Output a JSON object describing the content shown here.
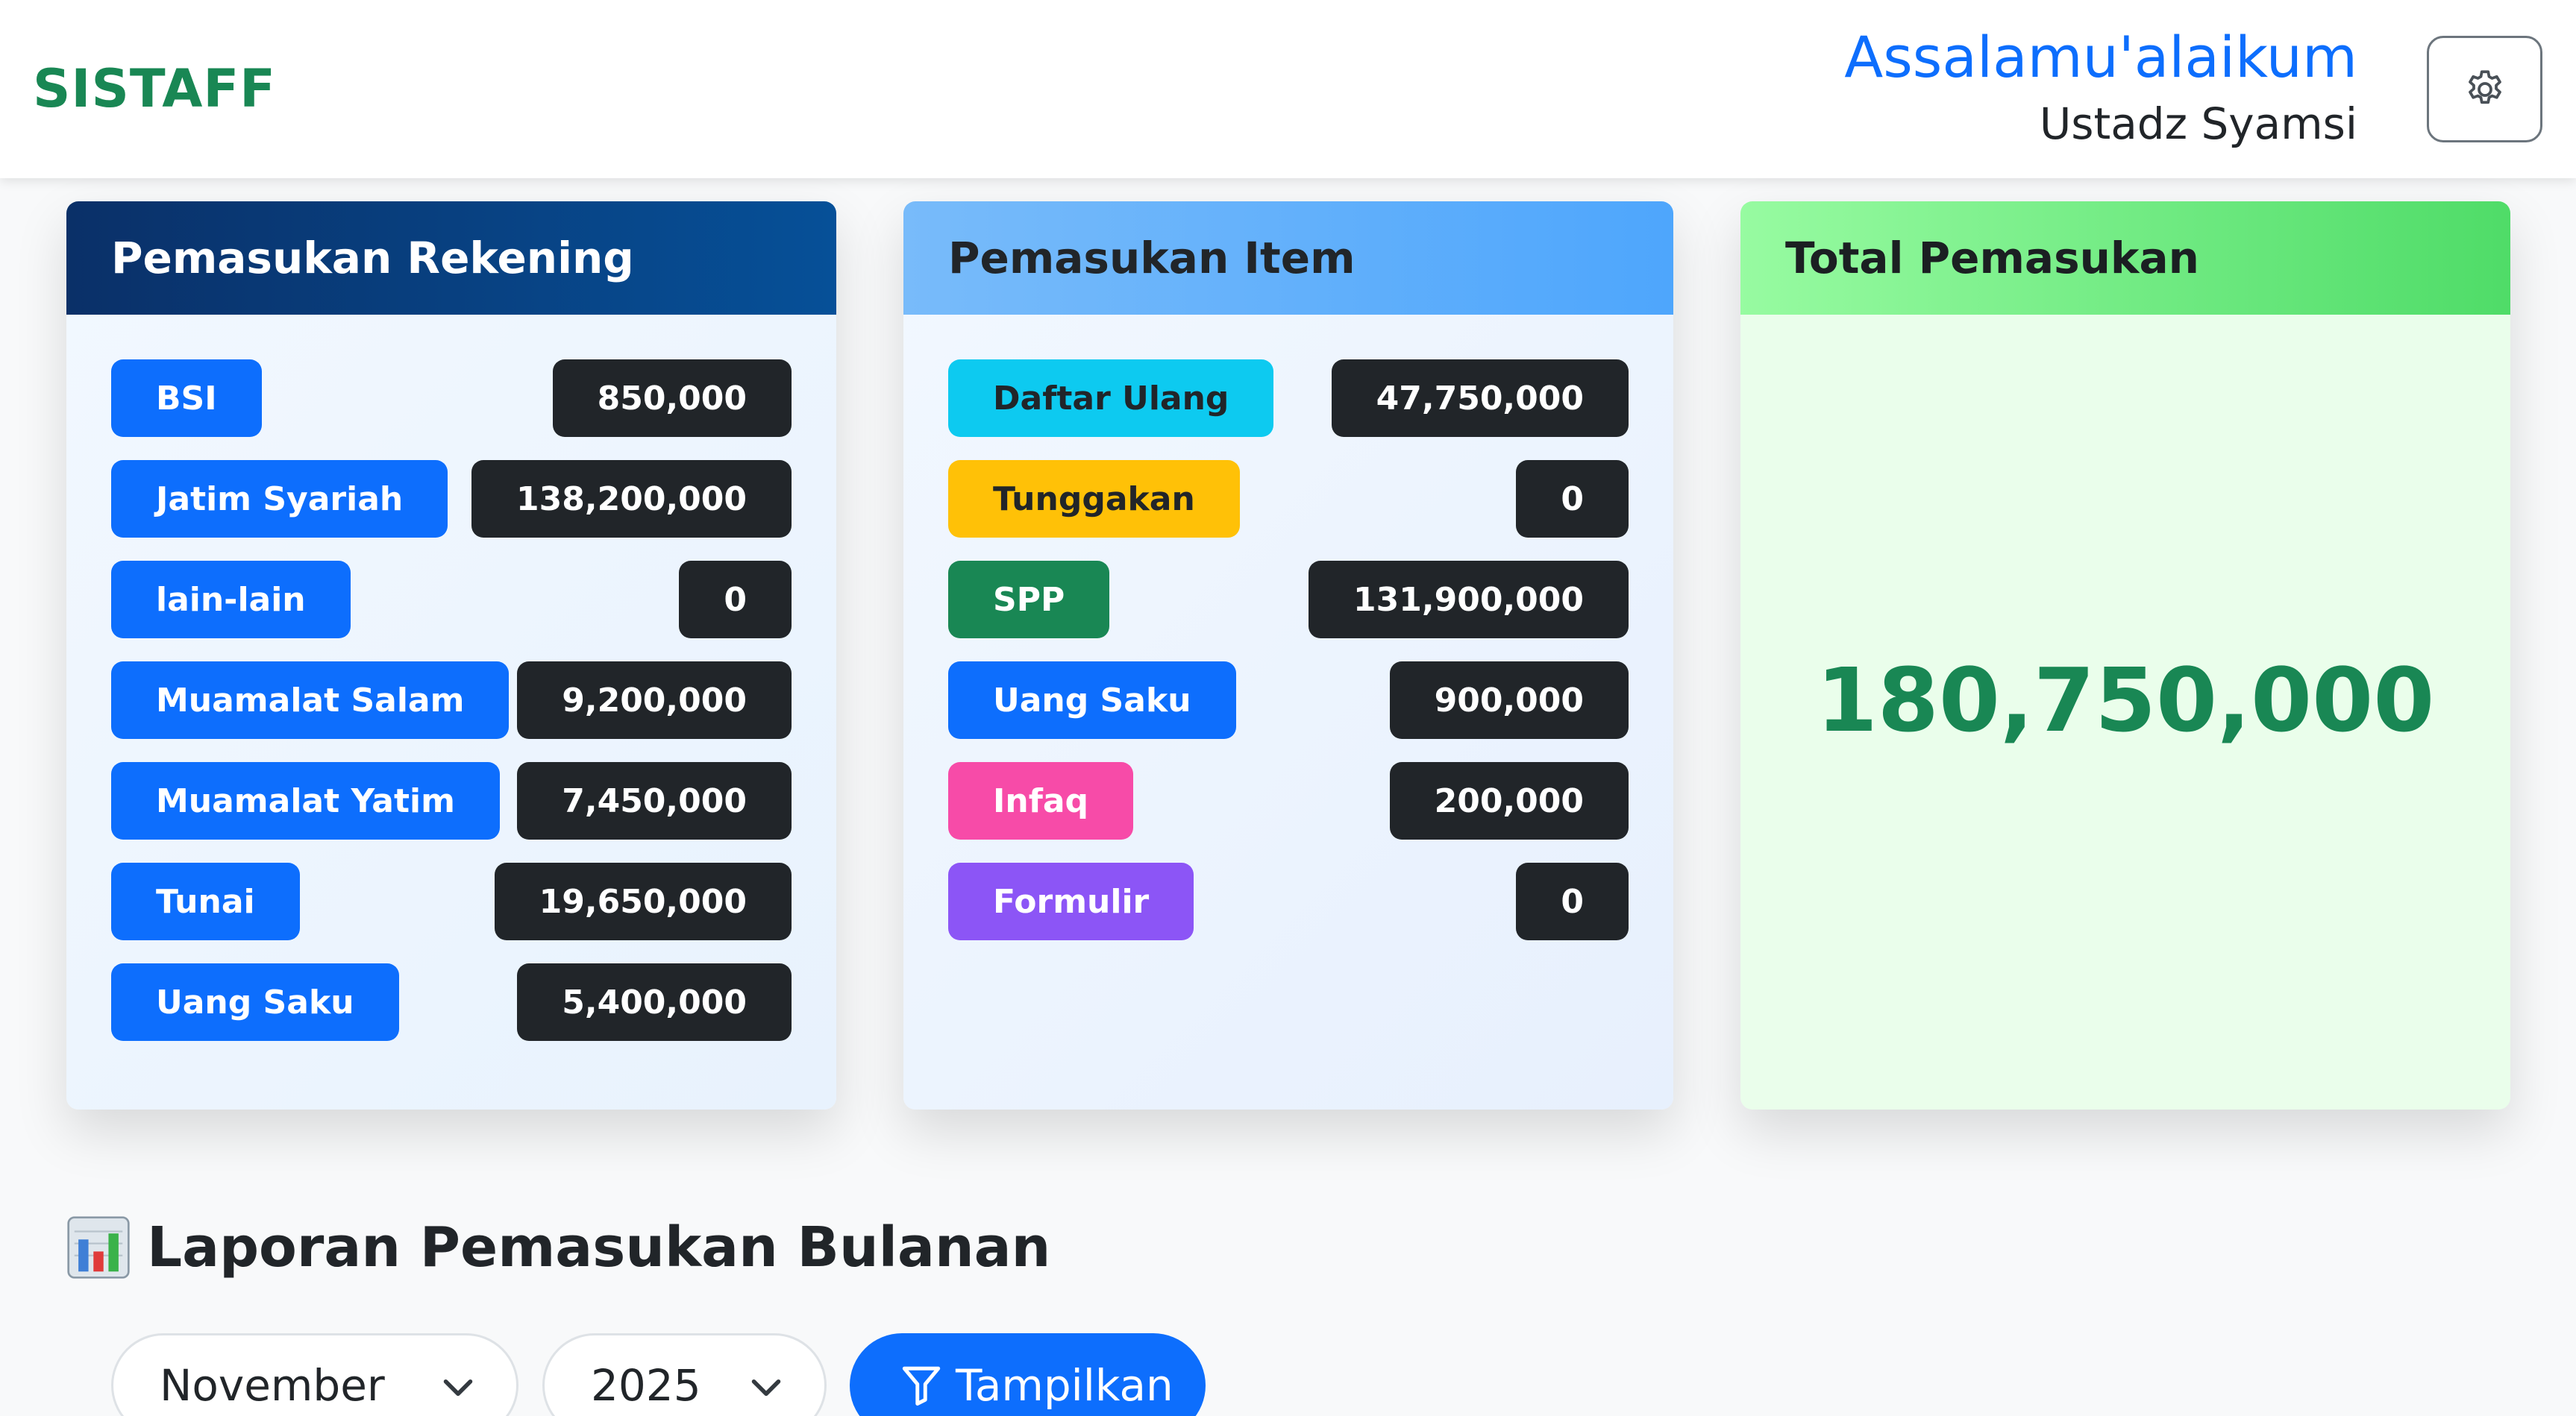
{
  "header": {
    "brand": "SISTAFF",
    "greeting": "Assalamu'alaikum",
    "user_name": "Ustadz Syamsi",
    "settings_icon": "gear-icon"
  },
  "rekening": {
    "title": "Pemasukan Rekening",
    "items": [
      {
        "label": "BSI",
        "value": "850,000",
        "color": "#0d6efd"
      },
      {
        "label": "Jatim Syariah",
        "value": "138,200,000",
        "color": "#0d6efd"
      },
      {
        "label": "lain-lain",
        "value": "0",
        "color": "#0d6efd"
      },
      {
        "label": "Muamalat Salam",
        "value": "9,200,000",
        "color": "#0d6efd"
      },
      {
        "label": "Muamalat Yatim",
        "value": "7,450,000",
        "color": "#0d6efd"
      },
      {
        "label": "Tunai",
        "value": "19,650,000",
        "color": "#0d6efd"
      },
      {
        "label": "Uang Saku",
        "value": "5,400,000",
        "color": "#0d6efd"
      }
    ]
  },
  "item": {
    "title": "Pemasukan Item",
    "items": [
      {
        "label": "Daftar Ulang",
        "value": "47,750,000",
        "color": "#0dcaf0",
        "text_color": "#212529"
      },
      {
        "label": "Tunggakan",
        "value": "0",
        "color": "#ffc107",
        "text_color": "#212529"
      },
      {
        "label": "SPP",
        "value": "131,900,000",
        "color": "#198754",
        "text_color": "#ffffff"
      },
      {
        "label": "Uang Saku",
        "value": "900,000",
        "color": "#0d6efd",
        "text_color": "#ffffff"
      },
      {
        "label": "Infaq",
        "value": "200,000",
        "color": "#f74ba8",
        "text_color": "#ffffff"
      },
      {
        "label": "Formulir",
        "value": "0",
        "color": "#8c55f6",
        "text_color": "#ffffff"
      }
    ]
  },
  "total": {
    "title": "Total Pemasukan",
    "value": "180,750,000"
  },
  "report": {
    "icon": "bar-chart-icon",
    "title": "Laporan Pemasukan Bulanan",
    "month": "November",
    "year": "2025",
    "button_label": "Tampilkan",
    "button_icon": "filter-icon"
  }
}
